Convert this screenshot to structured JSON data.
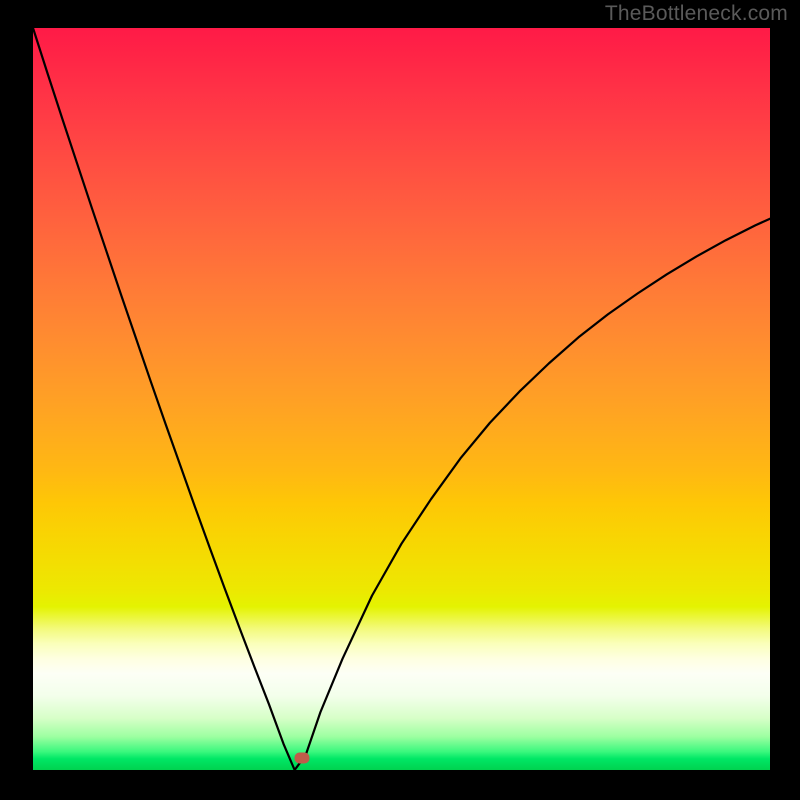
{
  "watermark": "TheBottleneck.com",
  "chart_data": {
    "type": "line",
    "title": "",
    "xlabel": "",
    "ylabel": "",
    "xlim": [
      0,
      100
    ],
    "ylim": [
      0,
      100
    ],
    "grid": false,
    "legend": false,
    "background": {
      "kind": "vertical-gradient",
      "stops": [
        {
          "pos": 0,
          "color": "#ff1a47"
        },
        {
          "pos": 50,
          "color": "#ffaa1e"
        },
        {
          "pos": 76,
          "color": "#ece901"
        },
        {
          "pos": 88,
          "color": "#fdfff6"
        },
        {
          "pos": 100,
          "color": "#00d24f"
        }
      ]
    },
    "series": [
      {
        "name": "bottleneck-curve",
        "color": "#000000",
        "x": [
          0,
          2,
          4,
          6,
          8,
          10,
          12,
          14,
          16,
          18,
          20,
          22,
          24,
          26,
          28,
          30,
          32,
          34,
          35.5,
          37,
          39,
          42,
          46,
          50,
          54,
          58,
          62,
          66,
          70,
          74,
          78,
          82,
          86,
          90,
          94,
          98,
          100
        ],
        "y": [
          100,
          93.8,
          87.7,
          81.7,
          75.7,
          69.8,
          63.9,
          58.1,
          52.3,
          46.6,
          41.0,
          35.4,
          29.9,
          24.5,
          19.2,
          14.0,
          8.9,
          3.5,
          0.0,
          2.0,
          7.8,
          15.0,
          23.5,
          30.5,
          36.5,
          42.0,
          46.8,
          51.0,
          54.8,
          58.3,
          61.4,
          64.2,
          66.8,
          69.2,
          71.4,
          73.4,
          74.3
        ]
      }
    ],
    "marker": {
      "x": 36.5,
      "y": 1.6,
      "color": "#c05c4a"
    }
  }
}
